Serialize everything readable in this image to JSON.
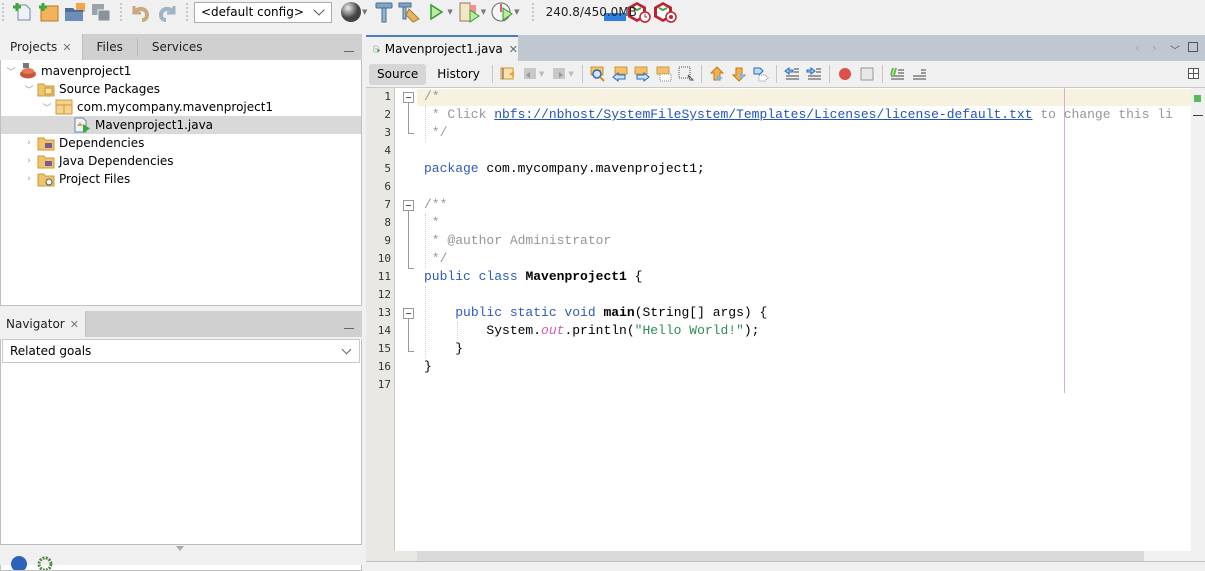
{
  "toolbar": {
    "icons": [
      "new-file-icon",
      "new-project-icon",
      "open-project-icon",
      "save-all-icon",
      "undo-icon",
      "redo-icon",
      "browser-icon",
      "build-icon",
      "clean-build-icon",
      "run-icon",
      "debug-icon",
      "profile-icon",
      "gc-icon",
      "profile-stop-icon"
    ],
    "config_select": "<default config>",
    "memory": "240.8/450.0MB",
    "memory_usage_fraction": 0.535
  },
  "projects_panel": {
    "tabs": [
      {
        "label": "Projects",
        "active": true
      },
      {
        "label": "Files",
        "active": false
      },
      {
        "label": "Services",
        "active": false
      }
    ],
    "tree": [
      {
        "label": "mavenproject1",
        "level": 0,
        "expanded": true,
        "icon": "maven-project-icon"
      },
      {
        "label": "Source Packages",
        "level": 1,
        "expanded": true,
        "icon": "source-folder-icon"
      },
      {
        "label": "com.mycompany.mavenproject1",
        "level": 2,
        "expanded": true,
        "icon": "package-icon"
      },
      {
        "label": "Mavenproject1.java",
        "level": 3,
        "selected": true,
        "icon": "java-file-icon"
      },
      {
        "label": "Dependencies",
        "level": 1,
        "expanded": false,
        "icon": "library-folder-icon"
      },
      {
        "label": "Java Dependencies",
        "level": 1,
        "expanded": false,
        "icon": "library-folder-icon"
      },
      {
        "label": "Project Files",
        "level": 1,
        "expanded": false,
        "icon": "config-folder-icon"
      }
    ]
  },
  "navigator": {
    "tab_label": "Navigator",
    "select_value": "Related goals"
  },
  "editor": {
    "tab_label": "Mavenproject1.java",
    "source_label": "Source",
    "history_label": "History",
    "active_view": "Source",
    "lines": [
      {
        "n": "1",
        "segments": [
          {
            "t": "/*",
            "c": "cm"
          }
        ]
      },
      {
        "n": "2",
        "segments": [
          {
            "t": " * Click ",
            "c": "cm"
          },
          {
            "t": "nbfs://nbhost/SystemFileSystem/Templates/Licenses/license-default.txt",
            "c": "link"
          },
          {
            "t": " to change this li",
            "c": "cm"
          }
        ]
      },
      {
        "n": "3",
        "segments": [
          {
            "t": " */",
            "c": "cm"
          }
        ]
      },
      {
        "n": "4",
        "segments": []
      },
      {
        "n": "5",
        "segments": [
          {
            "t": "package",
            "c": "kw"
          },
          {
            "t": " com.mycompany.mavenproject1;",
            "c": ""
          }
        ]
      },
      {
        "n": "6",
        "segments": []
      },
      {
        "n": "7",
        "segments": [
          {
            "t": "/**",
            "c": "cm"
          }
        ]
      },
      {
        "n": "8",
        "segments": [
          {
            "t": " *",
            "c": "cm"
          }
        ]
      },
      {
        "n": "9",
        "segments": [
          {
            "t": " * @author Administrator",
            "c": "cm"
          }
        ]
      },
      {
        "n": "10",
        "segments": [
          {
            "t": " */",
            "c": "cm"
          }
        ]
      },
      {
        "n": "11",
        "segments": [
          {
            "t": "public class",
            "c": "kw"
          },
          {
            "t": " ",
            "c": ""
          },
          {
            "t": "Mavenproject1",
            "c": "bold"
          },
          {
            "t": " {",
            "c": ""
          }
        ]
      },
      {
        "n": "12",
        "segments": []
      },
      {
        "n": "13",
        "segments": [
          {
            "t": "    ",
            "c": ""
          },
          {
            "t": "public static void",
            "c": "kw"
          },
          {
            "t": " ",
            "c": ""
          },
          {
            "t": "main",
            "c": "bold"
          },
          {
            "t": "(String[] args) {",
            "c": ""
          }
        ]
      },
      {
        "n": "14",
        "segments": [
          {
            "t": "        System.",
            "c": ""
          },
          {
            "t": "out",
            "c": "fld"
          },
          {
            "t": ".println(",
            "c": ""
          },
          {
            "t": "\"Hello World!\"",
            "c": "str"
          },
          {
            "t": ");",
            "c": ""
          }
        ]
      },
      {
        "n": "15",
        "segments": [
          {
            "t": "    }",
            "c": ""
          }
        ]
      },
      {
        "n": "16",
        "segments": [
          {
            "t": "}",
            "c": ""
          }
        ]
      },
      {
        "n": "17",
        "segments": []
      }
    ]
  }
}
